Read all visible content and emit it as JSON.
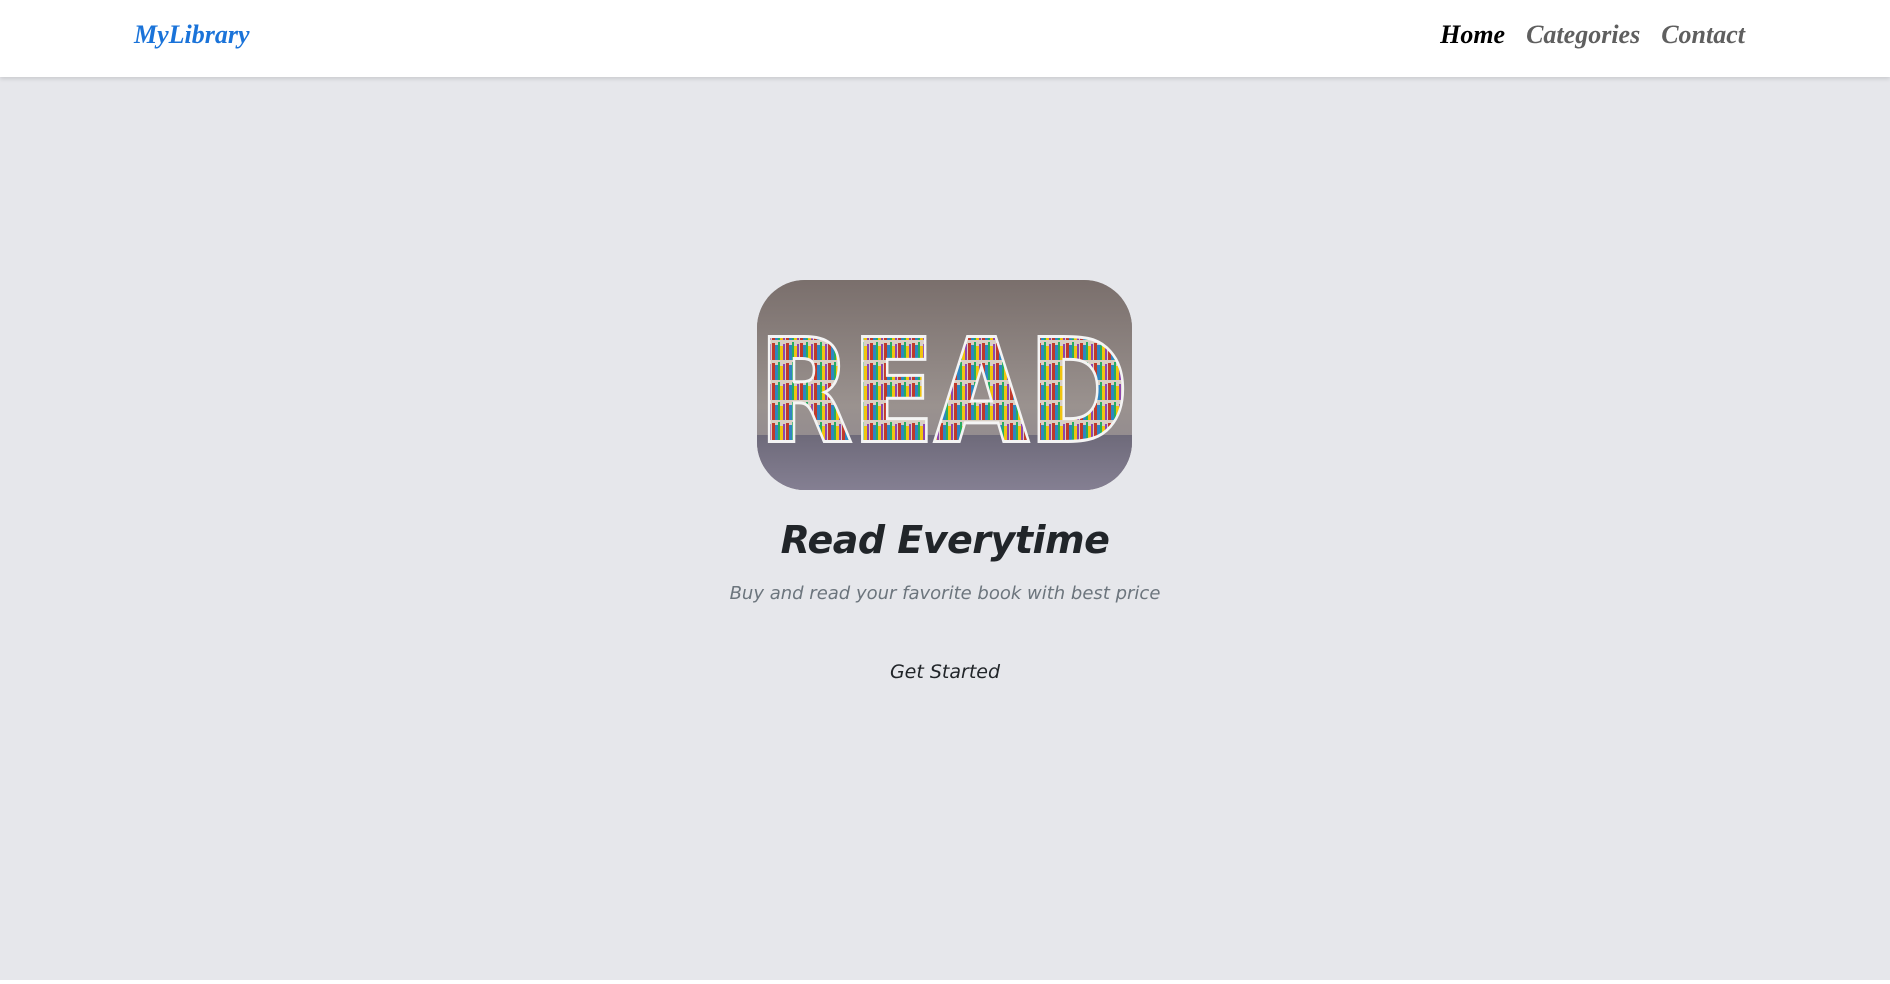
{
  "navbar": {
    "brand": "MyLibrary",
    "links": [
      {
        "label": "Home",
        "active": true
      },
      {
        "label": "Categories",
        "active": false
      },
      {
        "label": "Contact",
        "active": false
      }
    ]
  },
  "hero": {
    "image_text": "READ",
    "title": "Read Everytime",
    "subtitle": "Buy and read your favorite book with best price",
    "cta_label": "Get Started"
  },
  "colors": {
    "brand": "#1a73d9",
    "nav_active": "#000000",
    "nav_inactive": "#5f5f5f",
    "hero_background": "#e6e7eb"
  }
}
